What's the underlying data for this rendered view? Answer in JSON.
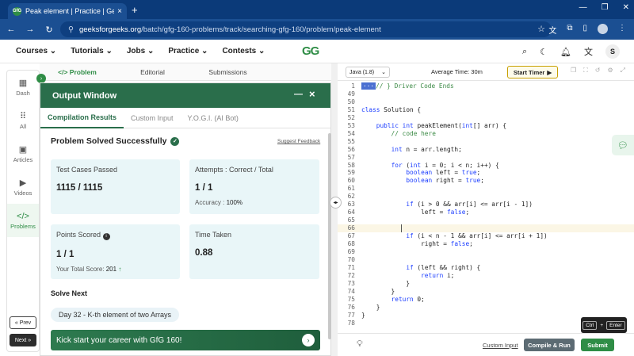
{
  "browser": {
    "tab_title": "Peak element | Practice | Geeks",
    "favicon": "GfG",
    "url_domain": "geeksforgeeks.org",
    "url_path": "/batch/gfg-160-problems/track/searching-gfg-160/problem/peak-element"
  },
  "site": {
    "menu": [
      "Courses",
      "Tutorials",
      "Jobs",
      "Practice",
      "Contests"
    ],
    "logo": "GG",
    "avatar_letter": "S"
  },
  "left_nav": {
    "items": [
      "Dash",
      "All",
      "Articles",
      "Videos",
      "Problems"
    ],
    "prev_label": "« Prev",
    "next_label": "Next »"
  },
  "problem_tabs": [
    "</> Problem",
    "Editorial",
    "Submissions"
  ],
  "output_window": {
    "title": "Output Window",
    "tabs": [
      "Compilation Results",
      "Custom Input",
      "Y.O.G.I. (AI Bot)"
    ],
    "status": "Problem Solved Successfully",
    "suggest_feedback": "Suggest Feedback",
    "test_cases_label": "Test Cases Passed",
    "test_cases_value": "1115 / 1115",
    "attempts_label": "Attempts : Correct / Total",
    "attempts_value": "1 / 1",
    "accuracy_label": "Accuracy :",
    "accuracy_value": "100%",
    "points_label": "Points Scored",
    "points_value": "1 / 1",
    "total_score_label": "Your Total Score:",
    "total_score_value": "201",
    "time_label": "Time Taken",
    "time_value": "0.88",
    "solve_next": "Solve Next",
    "next_problem": "Day 32 - K-th element of two Arrays",
    "banner": "Kick start your career with GfG 160!"
  },
  "editor": {
    "language": "Java (1.8)",
    "avg_time": "Average Time: 30m",
    "start_timer": "Start Timer",
    "lines": [
      {
        "n": "1",
        "t": "} Driver Code Ends"
      },
      {
        "n": "49",
        "t": ""
      },
      {
        "n": "50",
        "t": ""
      },
      {
        "n": "51",
        "t": "class Solution {"
      },
      {
        "n": "52",
        "t": ""
      },
      {
        "n": "53",
        "t": "    public int peakElement(int[] arr) {"
      },
      {
        "n": "54",
        "t": "        // code here"
      },
      {
        "n": "55",
        "t": ""
      },
      {
        "n": "56",
        "t": "        int n = arr.length;"
      },
      {
        "n": "57",
        "t": ""
      },
      {
        "n": "58",
        "t": "        for (int i = 0; i < n; i++) {"
      },
      {
        "n": "59",
        "t": "            boolean left = true;"
      },
      {
        "n": "60",
        "t": "            boolean right = true;"
      },
      {
        "n": "61",
        "t": ""
      },
      {
        "n": "62",
        "t": ""
      },
      {
        "n": "63",
        "t": "            if (i > 0 && arr[i] <= arr[i - 1])"
      },
      {
        "n": "64",
        "t": "                left = false;"
      },
      {
        "n": "65",
        "t": ""
      },
      {
        "n": "66",
        "t": ""
      },
      {
        "n": "67",
        "t": "            if (i < n - 1 && arr[i] <= arr[i + 1])"
      },
      {
        "n": "68",
        "t": "                right = false;"
      },
      {
        "n": "69",
        "t": ""
      },
      {
        "n": "70",
        "t": ""
      },
      {
        "n": "71",
        "t": "            if (left && right) {"
      },
      {
        "n": "72",
        "t": "                return i;"
      },
      {
        "n": "73",
        "t": "            }"
      },
      {
        "n": "74",
        "t": "        }"
      },
      {
        "n": "75",
        "t": "        return 0;"
      },
      {
        "n": "76",
        "t": "    }"
      },
      {
        "n": "77",
        "t": "}"
      },
      {
        "n": "78",
        "t": ""
      }
    ],
    "custom_input": "Custom Input",
    "compile_run": "Compile & Run",
    "submit": "Submit",
    "shortcut_ctrl": "Ctrl",
    "shortcut_plus": "+",
    "shortcut_enter": "Enter"
  },
  "colors": {
    "brand": "#2f8d46",
    "header": "#2a6e4b",
    "browser": "#1b4f92"
  }
}
